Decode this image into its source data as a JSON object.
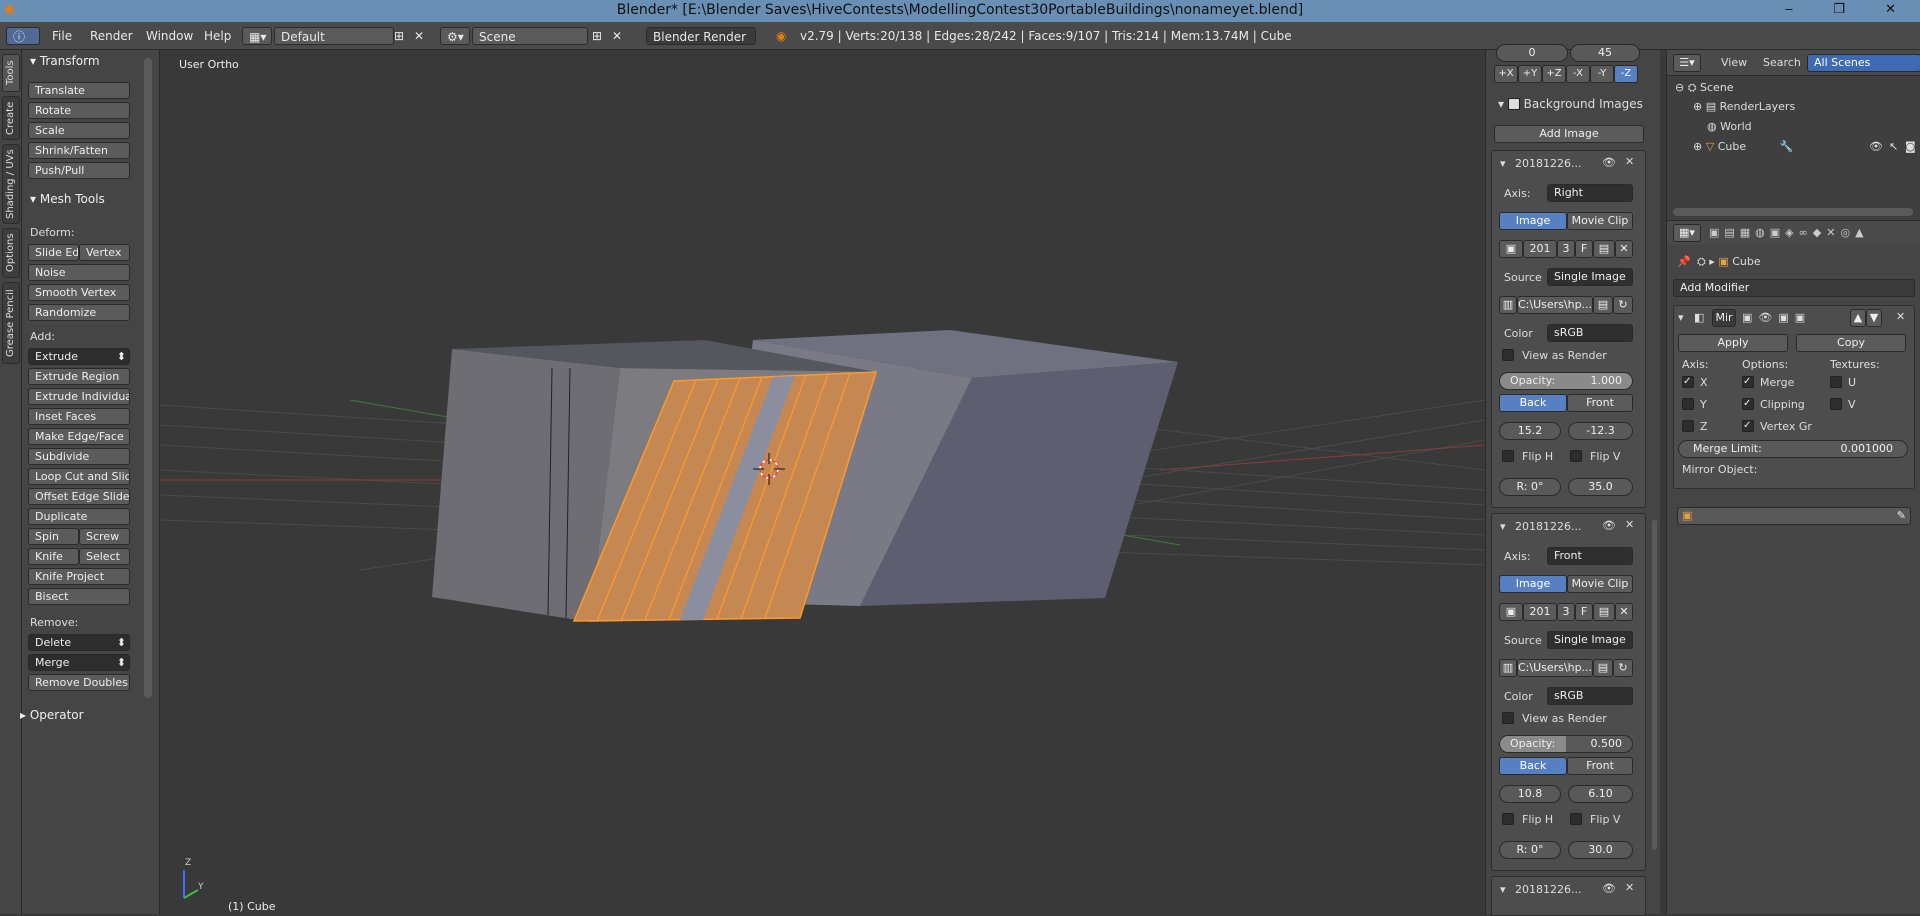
{
  "window": {
    "title": "Blender* [E:\\Blender Saves\\HiveContests\\ModellingContest30PortableBuildings\\nonameyet.blend]"
  },
  "menus": [
    "File",
    "Render",
    "Window",
    "Help"
  ],
  "screen_layout": "Default",
  "scene_name": "Scene",
  "render_engine": "Blender Render",
  "stats": "v2.79 | Verts:20/138 | Edges:28/242 | Faces:9/107 | Tris:214 | Mem:13.74M | Cube",
  "left_tabs": [
    "Tools",
    "Create",
    "Shading / UVs",
    "Options",
    "Grease Pencil"
  ],
  "toolshelf": {
    "transform_header": "Transform",
    "transform": [
      "Translate",
      "Rotate",
      "Scale",
      "Shrink/Fatten",
      "Push/Pull"
    ],
    "mesh_tools_header": "Mesh Tools",
    "deform_label": "Deform:",
    "slide_edge": "Slide Ed",
    "vertex": "Vertex",
    "noise": "Noise",
    "smooth_vertex": "Smooth Vertex",
    "randomize": "Randomize",
    "add_label": "Add:",
    "extrude": "Extrude",
    "add_tools": [
      "Extrude Region",
      "Extrude Individual",
      "Inset Faces",
      "Make Edge/Face",
      "Subdivide",
      "Loop Cut and Slide",
      "Offset Edge Slide",
      "Duplicate"
    ],
    "spin": "Spin",
    "screw": "Screw",
    "knife": "Knife",
    "select": "Select",
    "knife_project": "Knife Project",
    "bisect": "Bisect",
    "remove_label": "Remove:",
    "delete": "Delete",
    "merge": "Merge",
    "remove_doubles": "Remove Doubles",
    "operator_header": "Operator"
  },
  "viewport": {
    "view_name": "User Ortho",
    "object_label": "(1) Cube",
    "axis_z": "Z",
    "axis_y": "Y"
  },
  "npanel": {
    "top_values": [
      "0",
      "45"
    ],
    "axis_buttons": [
      "+X",
      "+Y",
      "+Z",
      "-X",
      "-Y",
      "-Z"
    ],
    "bg_header": "Background Images",
    "add_image": "Add Image",
    "images": [
      {
        "name": "20181226...",
        "axis_label": "Axis:",
        "axis": "Right",
        "tab_image": "Image",
        "tab_movie": "Movie Clip",
        "frame": "201",
        "num": "3",
        "f": "F",
        "source_label": "Source",
        "source": "Single Image",
        "path": "C:\\Users\\hp...",
        "color_label": "Color",
        "color": "sRGB",
        "view_as_render": "View as Render",
        "opacity_label": "Opacity:",
        "opacity": "1.000",
        "back": "Back",
        "front": "Front",
        "x": "15.2",
        "y": "-12.3",
        "flip_h": "Flip H",
        "flip_v": "Flip V",
        "rot": "R: 0°",
        "size": "35.0"
      },
      {
        "name": "20181226...",
        "axis_label": "Axis:",
        "axis": "Front",
        "tab_image": "Image",
        "tab_movie": "Movie Clip",
        "frame": "201",
        "num": "3",
        "f": "F",
        "source_label": "Source",
        "source": "Single Image",
        "path": "C:\\Users\\hp...",
        "color_label": "Color",
        "color": "sRGB",
        "view_as_render": "View as Render",
        "opacity_label": "Opacity:",
        "opacity": "0.500",
        "back": "Back",
        "front": "Front",
        "x": "10.8",
        "y": "6.10",
        "flip_h": "Flip H",
        "flip_v": "Flip V",
        "rot": "R: 0°",
        "size": "30.0"
      },
      {
        "name": "20181226..."
      }
    ]
  },
  "outliner": {
    "view": "View",
    "search": "Search",
    "scenes_dropdown": "All Scenes",
    "items": [
      "Scene",
      "RenderLayers",
      "World",
      "Cube"
    ]
  },
  "properties": {
    "object_name": "Cube",
    "add_modifier": "Add Modifier",
    "modifier_name": "Mir",
    "apply": "Apply",
    "copy": "Copy",
    "axis_label": "Axis:",
    "options_label": "Options:",
    "textures_label": "Textures:",
    "x": "X",
    "y": "Y",
    "z": "Z",
    "merge": "Merge",
    "clipping": "Clipping",
    "vertex_group": "Vertex Gr",
    "u": "U",
    "v": "V",
    "merge_limit_label": "Merge Limit:",
    "merge_limit": "0.001000",
    "mirror_object_label": "Mirror Object:"
  },
  "colors": {
    "accent": "#5680c2",
    "selection": "#ff9a2a",
    "face_selected": "#c78a52"
  }
}
